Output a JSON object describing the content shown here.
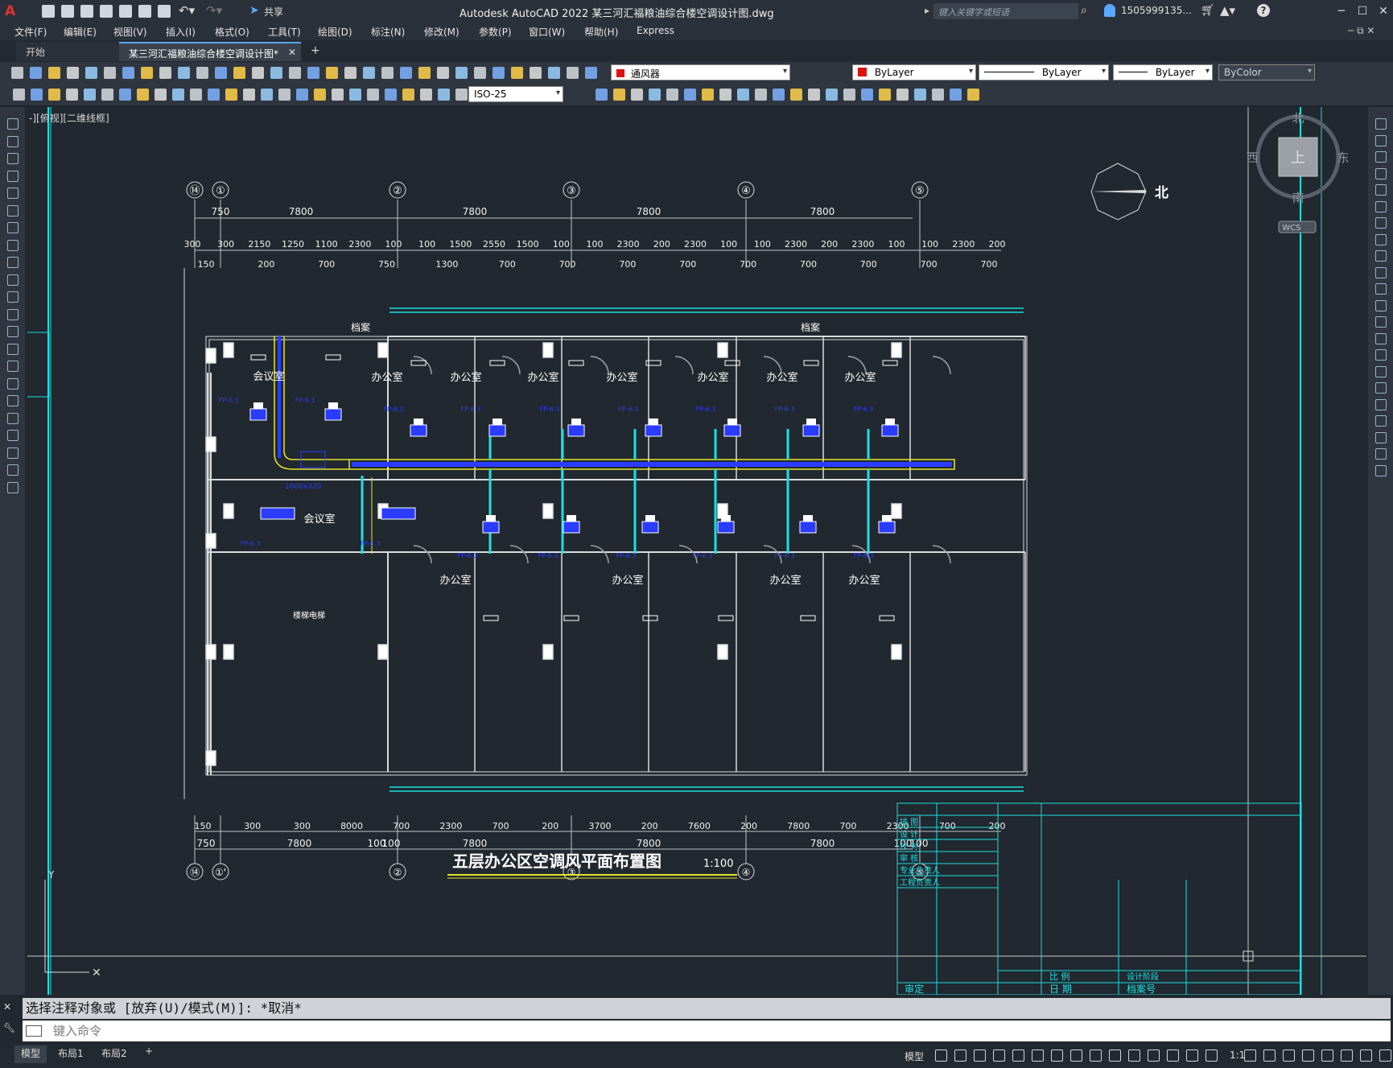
{
  "app": {
    "title": "Autodesk AutoCAD 2022    某三河汇福粮油综合楼空调设计图.dwg",
    "search_placeholder": "键入关键字或短语",
    "user": "1505999135...",
    "share_label": "共享"
  },
  "menu": [
    "文件(F)",
    "编辑(E)",
    "视图(V)",
    "插入(I)",
    "格式(O)",
    "工具(T)",
    "绘图(D)",
    "标注(N)",
    "修改(M)",
    "参数(P)",
    "窗口(W)",
    "帮助(H)",
    "Express"
  ],
  "tabs": [
    {
      "label": "开始"
    },
    {
      "label": "某三河汇福粮油综合楼空调设计图*"
    }
  ],
  "properties": {
    "layer": "通风器",
    "color": "ByLayer",
    "linetype": "ByLayer",
    "lineweight": "ByLayer",
    "plotstyle": "ByColor",
    "dimstyle": "ISO-25",
    "accent_red": "#e01010"
  },
  "viewport_label": "-][俯视][二维线框]",
  "viewcube": {
    "north": "北",
    "south": "南",
    "east": "东",
    "west": "西",
    "top": "上",
    "wcs": "WCS"
  },
  "drawing": {
    "grid_top": [
      "⑭",
      "①",
      "②",
      "③",
      "④",
      "⑤"
    ],
    "grid_bottom": [
      "⑭",
      "①'",
      "②",
      "③",
      "④",
      "⑤"
    ],
    "dim_top_main": [
      "750",
      "7800",
      "7800",
      "7800",
      "7800"
    ],
    "dim_top_detail": [
      "300",
      "300",
      "2150",
      "1250",
      "1100",
      "2300",
      "100",
      "100",
      "1500",
      "2550",
      "1500",
      "100",
      "100",
      "2300",
      "200",
      "2300",
      "100",
      "100",
      "2300",
      "200",
      "2300",
      "100",
      "100",
      "2300",
      "200"
    ],
    "dim_top_sub": [
      "150",
      "200",
      "700",
      "750",
      "1300",
      "700",
      "700",
      "700",
      "700",
      "700",
      "700",
      "700",
      "700",
      "700"
    ],
    "dim_bottom_detail": [
      "150",
      "300",
      "300",
      "8000",
      "700",
      "2300",
      "700",
      "200",
      "3700",
      "200",
      "7600",
      "200",
      "7800",
      "700",
      "2300",
      "700",
      "200"
    ],
    "dim_bottom_main": [
      "750",
      "7800",
      "100",
      "100",
      "7800",
      "7800",
      "7800",
      "100",
      "100"
    ],
    "north_label": "北",
    "rooms": {
      "meeting": "会议室",
      "office": "办公室",
      "archive": "档案",
      "stair": "楼梯电梯",
      "unit_label": "FP-6.3",
      "duct_label": "1000x320"
    },
    "drawing_title": "五层办公区空调风平面布置图",
    "scale": "1:100",
    "title_block": {
      "rows": [
        "描 图",
        "设 计",
        "校 对",
        "审 核",
        "专业负责人",
        "工程负责人"
      ],
      "bottom_left": "审定",
      "scale_label": "比 例",
      "date_label": "日 期",
      "stage_label": "设计阶段",
      "file_label": "档案号"
    }
  },
  "command": {
    "history": "选择注释对象或 [放弃(U)/模式(M)]: *取消*",
    "placeholder": "键入命令"
  },
  "layouts": [
    "模型",
    "布局1",
    "布局2"
  ],
  "status": {
    "model": "模型",
    "scale": "1:1"
  }
}
